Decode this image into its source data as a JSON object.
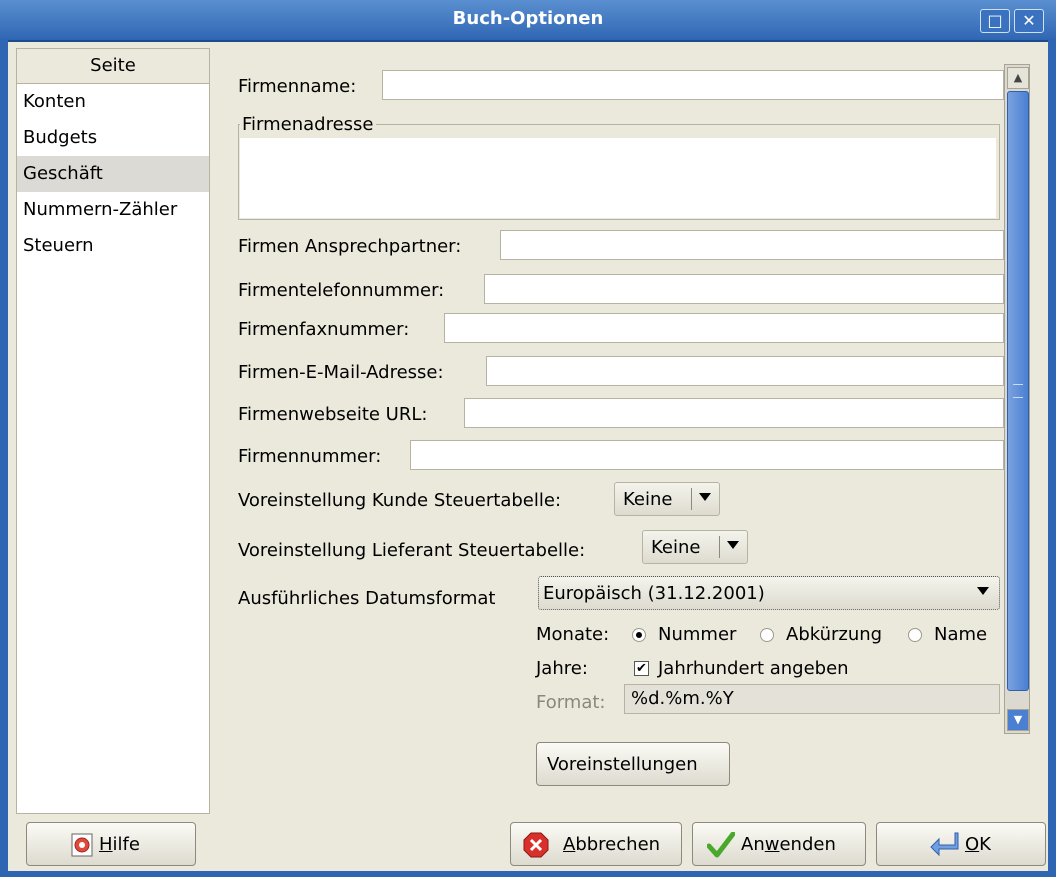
{
  "window": {
    "title": "Buch-Optionen",
    "maximize_glyph": "□",
    "close_glyph": "✕"
  },
  "sidebar": {
    "header": "Seite",
    "items": [
      {
        "label": "Konten"
      },
      {
        "label": "Budgets"
      },
      {
        "label": "Geschäft",
        "selected": true
      },
      {
        "label": "Nummern-Zähler"
      },
      {
        "label": "Steuern"
      }
    ]
  },
  "form": {
    "company_name_label": "Firmenname:",
    "company_name_value": "",
    "company_address_label": "Firmenadresse",
    "company_address_value": "",
    "contact_label": "Firmen Ansprechpartner:",
    "phone_label": "Firmentelefonnummer:",
    "fax_label": "Firmenfaxnummer:",
    "email_label": "Firmen-E-Mail-Adresse:",
    "website_label": "Firmenwebseite URL:",
    "company_id_label": "Firmennummer:",
    "customer_tax_label": "Voreinstellung Kunde Steuertabelle:",
    "customer_tax_value": "Keine",
    "vendor_tax_label": "Voreinstellung Lieferant Steuertabelle:",
    "vendor_tax_value": "Keine",
    "date_format_label": "Ausführliches Datumsformat",
    "date_format_value": "Europäisch (31.12.2001)",
    "months_label": "Monate:",
    "months_options": [
      "Nummer",
      "Abkürzung",
      "Name"
    ],
    "months_selected": "Nummer",
    "years_label": "Jahre:",
    "years_checkbox_label": "Jahrhundert angeben",
    "years_checked": true,
    "format_label": "Format:",
    "format_value": "%d.%m.%Y"
  },
  "buttons": {
    "defaults": "Voreinstellungen",
    "help_u": "H",
    "help_rest": "ilfe",
    "cancel_u": "A",
    "cancel_rest": "bbrechen",
    "apply_pre": "An",
    "apply_u": "w",
    "apply_rest": "enden",
    "ok_u": "O",
    "ok_rest": "K"
  },
  "colors": {
    "titlebar": "#2f66b3",
    "dialog_bg": "#ebe9dc",
    "scroll_thumb": "#4b7fd2"
  }
}
